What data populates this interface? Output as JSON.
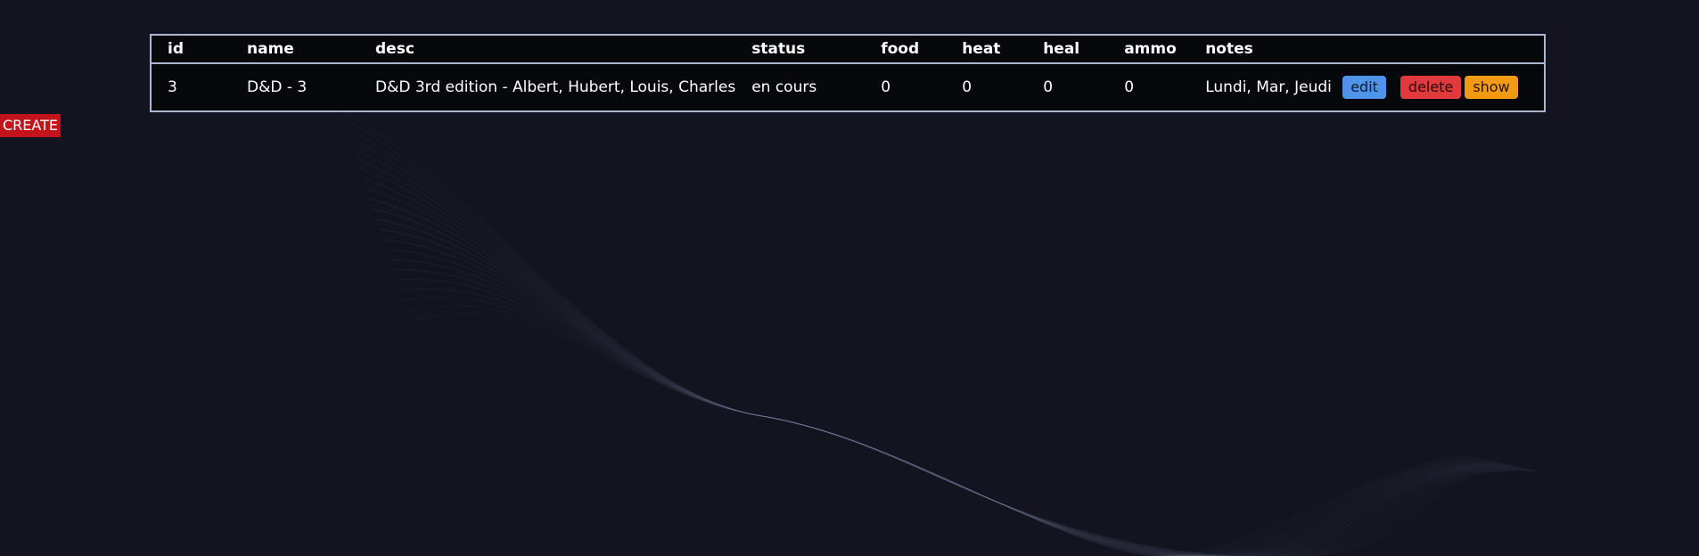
{
  "table": {
    "headers": [
      "id",
      "name",
      "desc",
      "status",
      "food",
      "heat",
      "heal",
      "ammo",
      "notes"
    ],
    "rows": [
      {
        "id": "3",
        "name": "D&D - 3",
        "desc": "D&D 3rd edition - Albert, Hubert, Louis, Charles",
        "status": "en cours",
        "food": "0",
        "heat": "0",
        "heal": "0",
        "ammo": "0",
        "notes": "Lundi, Mar, Jeudi",
        "edit_label": "edit",
        "delete_label": "delete",
        "show_label": "show"
      }
    ]
  },
  "create_label": "CREATE",
  "colors": {
    "background": "#13141f",
    "table_bg": "#07080c",
    "table_border": "#aab7cf",
    "edit": "#4f94e8",
    "delete": "#e03a3e",
    "show": "#f39a14",
    "create": "#c4141b"
  }
}
